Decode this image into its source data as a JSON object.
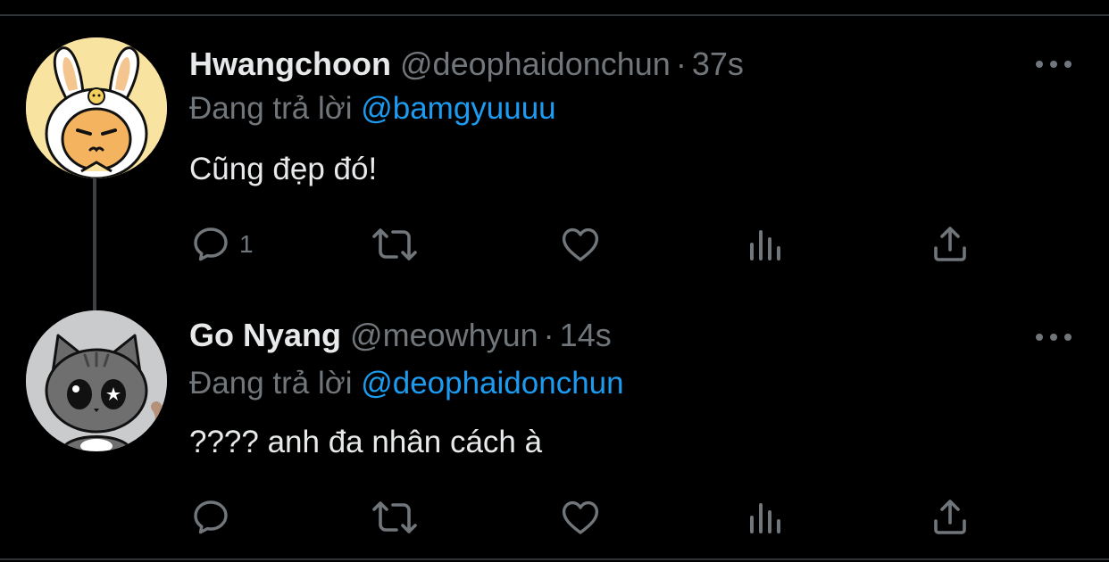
{
  "colors": {
    "background": "#000000",
    "primary_text": "#e7e9ea",
    "secondary_text": "#71767b",
    "mention": "#1d9bf0",
    "divider": "#2f3336"
  },
  "tweets": [
    {
      "display_name": "Hwangchoon",
      "handle": "@deophaidonchun",
      "separator": "·",
      "time": "37s",
      "reply_prefix": "Đang trả lời",
      "reply_to": "@bamgyuuuu",
      "text": "Cũng đẹp đó!",
      "reply_count": "1",
      "avatar": "yellow-bunny-avatar",
      "icons": [
        "reply-icon",
        "retweet-icon",
        "like-icon",
        "views-icon",
        "share-icon",
        "more-icon"
      ]
    },
    {
      "display_name": "Go Nyang",
      "handle": "@meowhyun",
      "separator": "·",
      "time": "14s",
      "reply_prefix": "Đang trả lời",
      "reply_to": "@deophaidonchun",
      "text": "???? anh đa nhân cách à",
      "reply_count": "",
      "avatar": "gray-cat-avatar",
      "icons": [
        "reply-icon",
        "retweet-icon",
        "like-icon",
        "views-icon",
        "share-icon",
        "more-icon"
      ]
    }
  ]
}
